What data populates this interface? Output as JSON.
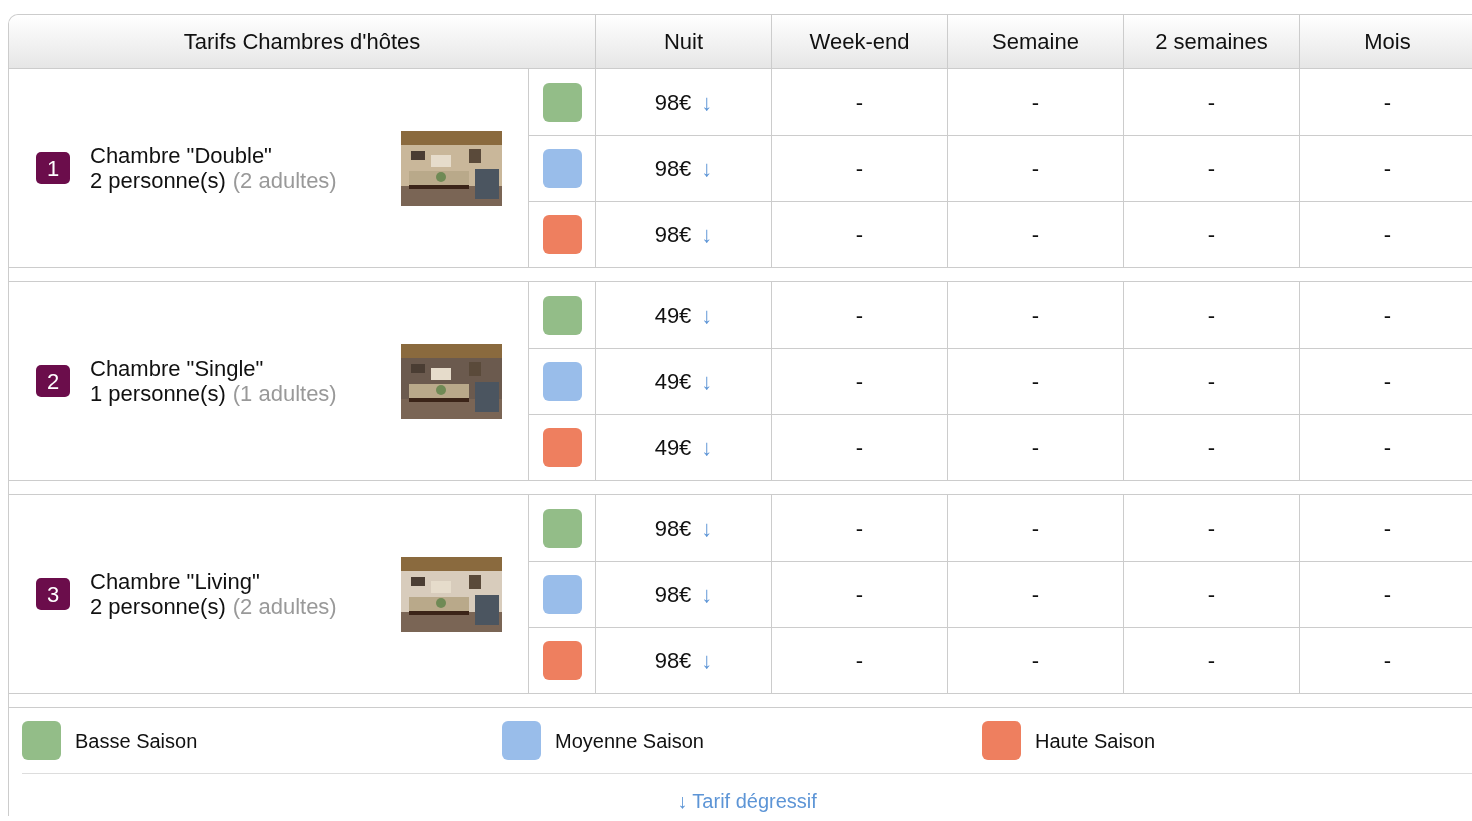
{
  "table": {
    "columns": [
      "Tarifs Chambres d'hôtes",
      "Nuit",
      "Week-end",
      "Semaine",
      "2 semaines",
      "Mois"
    ],
    "rooms": [
      {
        "number": "1",
        "name": "Chambre \"Double\"",
        "capacity": "2 personne(s)",
        "detail": "(2 adultes)",
        "photo": {
          "kind": "picture"
        },
        "rates": [
          {
            "color": "#93bd88",
            "price": "98€",
            "arrow": "↓",
            "cells": [
              "-",
              "-",
              "-",
              "-"
            ]
          },
          {
            "color": "#99bdea",
            "price": "98€",
            "arrow": "↓",
            "cells": [
              "-",
              "-",
              "-",
              "-"
            ]
          },
          {
            "color": "#ee7f5f",
            "price": "98€",
            "arrow": "↓",
            "cells": [
              "-",
              "-",
              "-",
              "-"
            ]
          }
        ]
      },
      {
        "number": "2",
        "name": "Chambre \"Single\"",
        "capacity": "1 personne(s)",
        "detail": "(1 adultes)",
        "photo": {
          "kind": "picture"
        },
        "rates": [
          {
            "color": "#93bd88",
            "price": "49€",
            "arrow": "↓",
            "cells": [
              "-",
              "-",
              "-",
              "-"
            ]
          },
          {
            "color": "#99bdea",
            "price": "49€",
            "arrow": "↓",
            "cells": [
              "-",
              "-",
              "-",
              "-"
            ]
          },
          {
            "color": "#ee7f5f",
            "price": "49€",
            "arrow": "↓",
            "cells": [
              "-",
              "-",
              "-",
              "-"
            ]
          }
        ]
      },
      {
        "number": "3",
        "name": "Chambre \"Living\"",
        "capacity": "2 personne(s)",
        "detail": "(2 adultes)",
        "photo": {
          "kind": "picture"
        },
        "rates": [
          {
            "color": "#93bd88",
            "price": "98€",
            "arrow": "↓",
            "cells": [
              "-",
              "-",
              "-",
              "-"
            ]
          },
          {
            "color": "#99bdea",
            "price": "98€",
            "arrow": "↓",
            "cells": [
              "-",
              "-",
              "-",
              "-"
            ]
          },
          {
            "color": "#ee7f5f",
            "price": "98€",
            "arrow": "↓",
            "cells": [
              "-",
              "-",
              "-",
              "-"
            ]
          }
        ]
      }
    ]
  },
  "legend": [
    {
      "label": "Basse Saison",
      "color": "#93bd88"
    },
    {
      "label": "Moyenne Saison",
      "color": "#99bdea"
    },
    {
      "label": "Haute Saison",
      "color": "#ee7f5f"
    }
  ],
  "footnote": "↓ Tarif dégressif"
}
